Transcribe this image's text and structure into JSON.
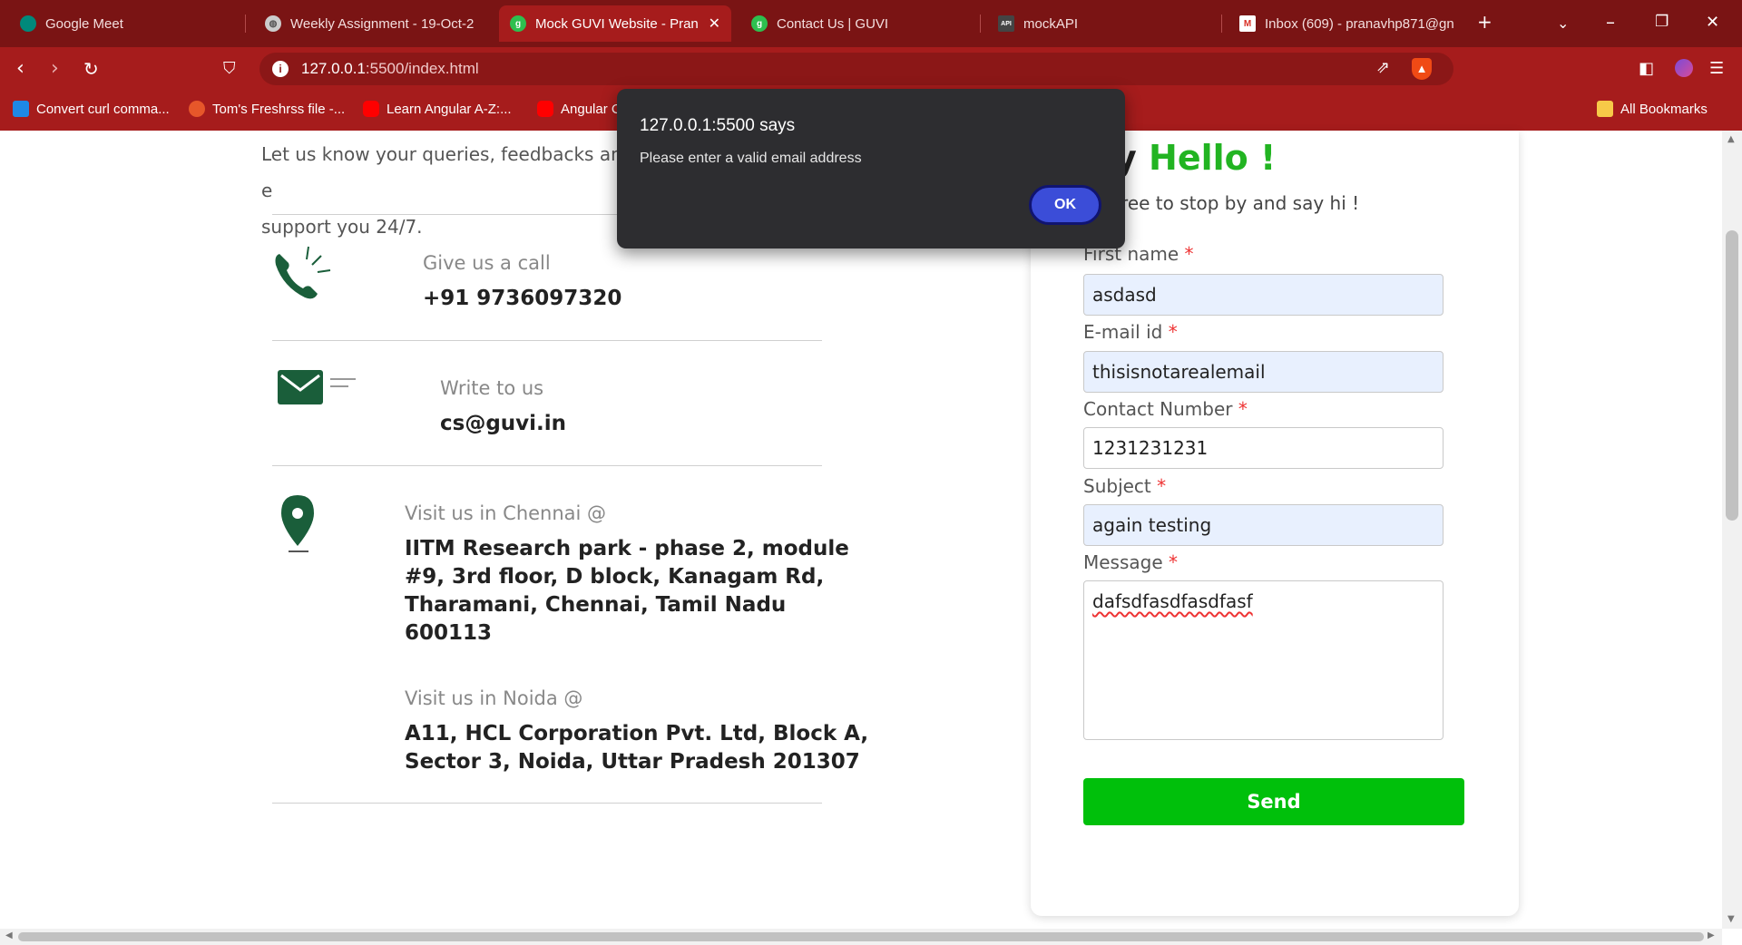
{
  "browser": {
    "tabs": [
      {
        "title": "Google Meet",
        "active": false
      },
      {
        "title": "Weekly Assignment - 19-Oct-2",
        "active": false
      },
      {
        "title": "Mock GUVI Website - Pran",
        "active": true
      },
      {
        "title": "Contact Us | GUVI",
        "active": false
      },
      {
        "title": "mockAPI",
        "active": false
      },
      {
        "title": "Inbox (609) - pranavhp871@gn",
        "active": false
      }
    ],
    "url_host": "127.0.0.1",
    "url_path": ":5500/index.html",
    "bookmarks": [
      {
        "label": "Convert curl comma..."
      },
      {
        "label": "Tom's Freshrss file -..."
      },
      {
        "label": "Learn Angular A-Z:..."
      },
      {
        "label": "Angular C"
      },
      {
        "label": "All Bookmarks"
      }
    ],
    "colors": {
      "tabbar": "#7a1414",
      "toolbar": "#a61c1c"
    }
  },
  "page": {
    "intro_line1": "Let us know your queries, feedbacks and e",
    "intro_line2": "support you 24/7.",
    "call": {
      "label": "Give us a call",
      "value": "+91 9736097320"
    },
    "write": {
      "label": "Write to us",
      "value": "cs@guvi.in"
    },
    "chennai": {
      "label": "Visit us in Chennai @",
      "lines": [
        "IITM Research park - phase 2, module",
        "#9, 3rd floor, D block, Kanagam Rd,",
        "Tharamani, Chennai, Tamil Nadu",
        "600113"
      ]
    },
    "noida": {
      "label": "Visit us in Noida @",
      "lines": [
        "A11, HCL Corporation Pvt. Ltd, Block A,",
        "Sector 3, Noida, Uttar Pradesh 201307"
      ]
    }
  },
  "form": {
    "greeting_prefix": "y",
    "greeting_highlight": "Hello !",
    "subgreeting": "free to stop by and say hi !",
    "required_mark": "*",
    "fields": {
      "first_name": {
        "label": "First name",
        "value": "asdasd"
      },
      "email": {
        "label": "E-mail id",
        "value": "thisisnotarealemail"
      },
      "contact": {
        "label": "Contact Number",
        "value": "1231231231"
      },
      "subject": {
        "label": "Subject",
        "value": "again testing"
      },
      "message": {
        "label": "Message",
        "value": "dafsdfasdfasdfasf"
      }
    },
    "send_label": "Send",
    "colors": {
      "accent": "#00c00b",
      "greeting": "#22b422",
      "required": "#e33333"
    }
  },
  "dialog": {
    "title": "127.0.0.1:5500 says",
    "message": "Please enter a valid email address",
    "ok_label": "OK"
  }
}
